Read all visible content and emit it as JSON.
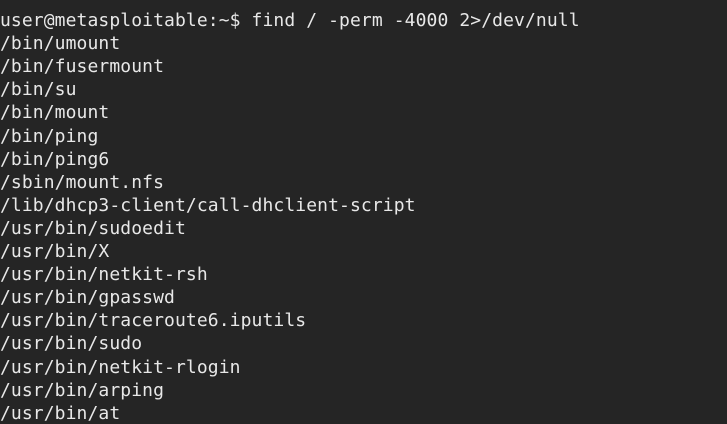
{
  "terminal": {
    "prompt_line": "user@metasploitable:~$ find / -perm -4000 2>/dev/null",
    "output": [
      "/bin/umount",
      "/bin/fusermount",
      "/bin/su",
      "/bin/mount",
      "/bin/ping",
      "/bin/ping6",
      "/sbin/mount.nfs",
      "/lib/dhcp3-client/call-dhclient-script",
      "/usr/bin/sudoedit",
      "/usr/bin/X",
      "/usr/bin/netkit-rsh",
      "/usr/bin/gpasswd",
      "/usr/bin/traceroute6.iputils",
      "/usr/bin/sudo",
      "/usr/bin/netkit-rlogin",
      "/usr/bin/arping",
      "/usr/bin/at"
    ]
  },
  "colors": {
    "background": "#252525",
    "text": "#e8e8e8"
  }
}
